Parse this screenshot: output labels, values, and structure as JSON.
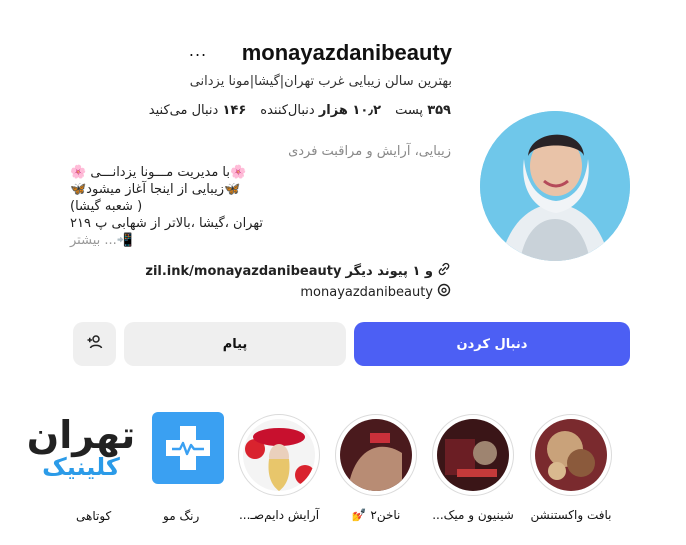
{
  "profile": {
    "username": "monayazdanibeauty",
    "more_glyph": "...",
    "bio_title": "بهترین سالن زیبایی غرب تهران|گیشا|مونا یزدانی",
    "stats": {
      "posts_count": "۳۵۹",
      "posts_label": "پست",
      "followers_count": "۱۰٫۲ هزار",
      "followers_label": "دنبال‌کننده",
      "following_count": "۱۴۶",
      "following_label": "دنبال می‌کنید"
    },
    "category": "زیبایی، آرایش و مراقبت فردی",
    "bio_lines": [
      "🌸با مدیریت مـــونا یزدانـــی 🌸",
      "🦋زیبایی از اینجا آغاز میشود🦋",
      "( شعبه گیشا)",
      "تهران ،گیشا ،بالاتر از شهابی پ ۲۱۹",
      "📲... بیشتر"
    ],
    "link_text": "zil.ink/monayazdanibeauty",
    "link_extra": "و ۱ پیوند دیگر",
    "threads_handle": "monayazdanibeauty"
  },
  "buttons": {
    "follow": "دنبال کردن",
    "message": "پیام"
  },
  "highlights": [
    {
      "label": "بافت واکستنشن"
    },
    {
      "label": "شینیون و میک..."
    },
    {
      "label": "ناخن۲ 💅"
    },
    {
      "label": "آرایش دایم‌صـ..."
    },
    {
      "label": "رنگ مو"
    },
    {
      "label": "کوتاهی"
    }
  ],
  "watermark": {
    "line1": "تهران",
    "line2": "کلینیک"
  },
  "colors": {
    "accent": "#4c5ff4",
    "secondary_button": "#efefef",
    "watermark_blue": "#3aa0f2"
  }
}
